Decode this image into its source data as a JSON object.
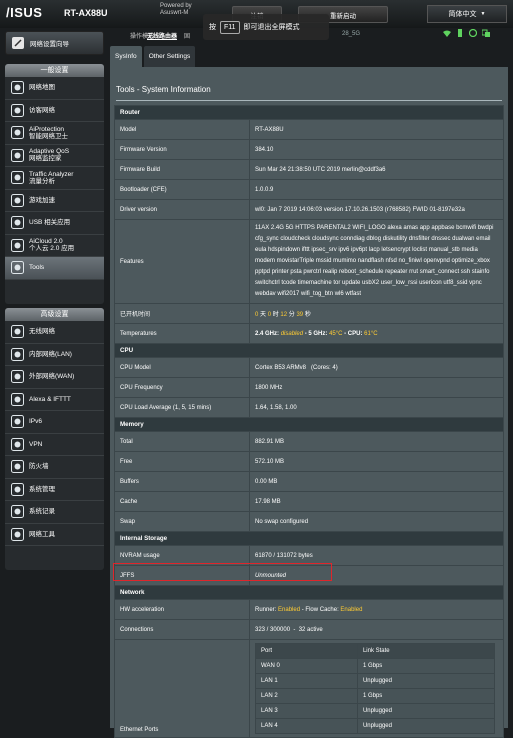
{
  "header": {
    "brand": "/ISUS",
    "model": "RT-AX88U",
    "powered_line1": "Powered by",
    "powered_line2": "Asuswrt-M",
    "btn_logout": "注销",
    "btn_reboot": "重新启动",
    "language": "简体中文",
    "f11_prefix": "按",
    "f11_key": "F11",
    "f11_suffix": "即可退出全屏模式",
    "op_mode_label": "操作模式:",
    "op_mode_value": "无线路由器",
    "op_fw": "固",
    "ssid_fragment": "28_5G"
  },
  "sidebar": {
    "qis": "网络设置向导",
    "general_title": "一般设置",
    "general_items": [
      {
        "name": "网络地图",
        "icon": "network-map-icon"
      },
      {
        "name": "访客网络",
        "icon": "guest-network-icon"
      },
      {
        "name": "AiProtection",
        "sub": "智能网络卫士",
        "icon": "aiprotection-icon"
      },
      {
        "name": "Adaptive QoS",
        "sub": "网络监控家",
        "icon": "qos-icon"
      },
      {
        "name": "Traffic Analyzer",
        "sub": "流量分析",
        "icon": "traffic-analyzer-icon"
      },
      {
        "name": "游戏加速",
        "icon": "game-boost-icon"
      },
      {
        "name": "USB 相关应用",
        "icon": "usb-icon"
      },
      {
        "name": "AiCloud 2.0",
        "sub": "个人云 2.0 应用",
        "icon": "aicloud-icon"
      },
      {
        "name": "Tools",
        "icon": "tools-icon"
      }
    ],
    "advanced_title": "高级设置",
    "advanced_items": [
      {
        "name": "无线网络",
        "icon": "wireless-icon"
      },
      {
        "name": "内部网络(LAN)",
        "icon": "lan-icon"
      },
      {
        "name": "外部网络(WAN)",
        "icon": "wan-icon"
      },
      {
        "name": "Alexa & IFTTT",
        "icon": "alexa-icon"
      },
      {
        "name": "IPv6",
        "icon": "ipv6-icon"
      },
      {
        "name": "VPN",
        "icon": "vpn-icon"
      },
      {
        "name": "防火墙",
        "icon": "firewall-icon"
      },
      {
        "name": "系统管理",
        "icon": "admin-icon"
      },
      {
        "name": "系统记录",
        "icon": "syslog-icon"
      },
      {
        "name": "网络工具",
        "icon": "network-tools-icon"
      }
    ]
  },
  "tabs": [
    "SysInfo",
    "Other Settings"
  ],
  "page_title": "Tools - System Information",
  "router": {
    "section": "Router",
    "model_label": "Model",
    "model": "RT-AX88U",
    "fw_version_label": "Firmware Version",
    "fw_version": "384.10",
    "fw_build_label": "Firmware Build",
    "fw_build": "Sun Mar 24 21:38:50 UTC 2019 merlin@cddf3a6",
    "bootloader_label": "Bootloader (CFE)",
    "bootloader": "1.0.0.9",
    "driver_label": "Driver version",
    "driver": "wl0: Jan 7 2019 14:06:03 version 17.10.26.1503 (r768582) FWID 01-8197e32a",
    "features_label": "Features",
    "features": "11AX 2.4G 5G HTTPS PARENTAL2 WIFI_LOGO alexa amas app appbase bcmwifi bwdpi cfg_sync cloudcheck cloudsync conndiag dblog diskutility dnsfilter dnssec dualwan email eula hdspindown ifttt ipsec_srv ipv6 ipv6pt lacp letsencrypt loclist manual_stb media modem movistarTriple mssid mumimo nandflash nfsd no_finiwl openvpnd optimize_xbox pptpd printer psta pwrctrl realip reboot_schedule repeater rrut smart_connect ssh stainfo switchctrl tcode timemachine tor update usbX2 user_low_rssi usericon utf8_ssid vpnc webdav wifi2017 wifi_tog_btn wl6 wtfast",
    "uptime_label": "已开机时间",
    "uptime_days": "0",
    "uptime_days_unit": "天",
    "uptime_hours": "0",
    "uptime_hours_unit": "时",
    "uptime_mins": "12",
    "uptime_mins_unit": "分",
    "uptime_secs": "39",
    "uptime_secs_unit": "秒",
    "temp_label": "Temperatures",
    "temp_24_label": "2.4 GHz:",
    "temp_24": "disabled",
    "temp_5_label": "- 5 GHz:",
    "temp_5": "45°C",
    "temp_cpu_label": "- CPU:",
    "temp_cpu": "61°C"
  },
  "cpu": {
    "section": "CPU",
    "model_label": "CPU Model",
    "model": "Cortex B53 ARMv8   (Cores: 4)",
    "freq_label": "CPU Frequency",
    "freq": "1800 MHz",
    "load_label": "CPU Load Average (1, 5, 15 mins)",
    "load": "1.64, 1.58, 1.00"
  },
  "memory": {
    "section": "Memory",
    "total_label": "Total",
    "total": "882.91 MB",
    "free_label": "Free",
    "free": "572.10 MB",
    "buffers_label": "Buffers",
    "buffers": "0.00 MB",
    "cache_label": "Cache",
    "cache": "17.98 MB",
    "swap_label": "Swap",
    "swap": "No swap configured"
  },
  "storage": {
    "section": "Internal Storage",
    "nvram_label": "NVRAM usage",
    "nvram": "61870 / 131072 bytes",
    "jffs_label": "JFFS",
    "jffs": "Unmounted"
  },
  "network": {
    "section": "Network",
    "hwaccel_label": "HW acceleration",
    "runner_label": "Runner:",
    "runner": "Enabled",
    "flow_label": "- Flow Cache:",
    "flow": "Enabled",
    "conn_label": "Connections",
    "conn": "323 / 300000  -  32 active",
    "ports_label": "Ethernet Ports",
    "ports_head": [
      "Port",
      "Link State"
    ],
    "ports": [
      [
        "WAN 0",
        "1 Gbps"
      ],
      [
        "LAN 1",
        "Unplugged"
      ],
      [
        "LAN 2",
        "1 Gbps"
      ],
      [
        "LAN 3",
        "Unplugged"
      ],
      [
        "LAN 4",
        "Unplugged"
      ]
    ]
  },
  "colors": {
    "accent": "#ffcc33",
    "highlight": "#e0252b",
    "panel": "#4d595d"
  }
}
